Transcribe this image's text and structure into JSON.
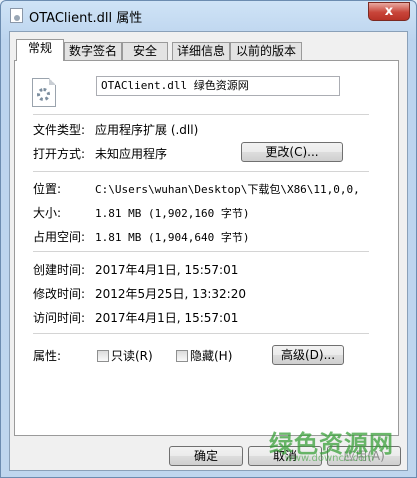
{
  "window": {
    "title": "OTAClient.dll 属性",
    "close_label": "x"
  },
  "tabs": [
    {
      "label": "常规",
      "active": true
    },
    {
      "label": "数字签名",
      "active": false
    },
    {
      "label": "安全",
      "active": false
    },
    {
      "label": "详细信息",
      "active": false
    },
    {
      "label": "以前的版本",
      "active": false
    }
  ],
  "general": {
    "file_name": "OTAClient.dll 绿色资源网",
    "file_type_label": "文件类型:",
    "file_type_value": "应用程序扩展 (.dll)",
    "opens_with_label": "打开方式:",
    "opens_with_value": "未知应用程序",
    "change_button": "更改(C)...",
    "location_label": "位置:",
    "location_value": "C:\\Users\\wuhan\\Desktop\\下载包\\X86\\11,0,0,",
    "size_label": "大小:",
    "size_value": "1.81 MB (1,902,160 字节)",
    "size_on_disk_label": "占用空间:",
    "size_on_disk_value": "1.81 MB (1,904,640 字节)",
    "created_label": "创建时间:",
    "created_value": "2017年4月1日, 15:57:01",
    "modified_label": "修改时间:",
    "modified_value": "2012年5月25日, 13:32:20",
    "accessed_label": "访问时间:",
    "accessed_value": "2017年4月1日, 15:57:01",
    "attributes_label": "属性:",
    "readonly_label": "只读(R)",
    "hidden_label": "隐藏(H)",
    "advanced_button": "高级(D)..."
  },
  "footer": {
    "ok": "确定",
    "cancel": "取消",
    "apply": "应用(A)"
  },
  "watermark": {
    "text": "绿色资源网",
    "url": "www.downcc.com"
  },
  "colors": {
    "title_bar": "#bcd4ee",
    "close": "#c8453a",
    "watermark": "#3aa13a"
  }
}
